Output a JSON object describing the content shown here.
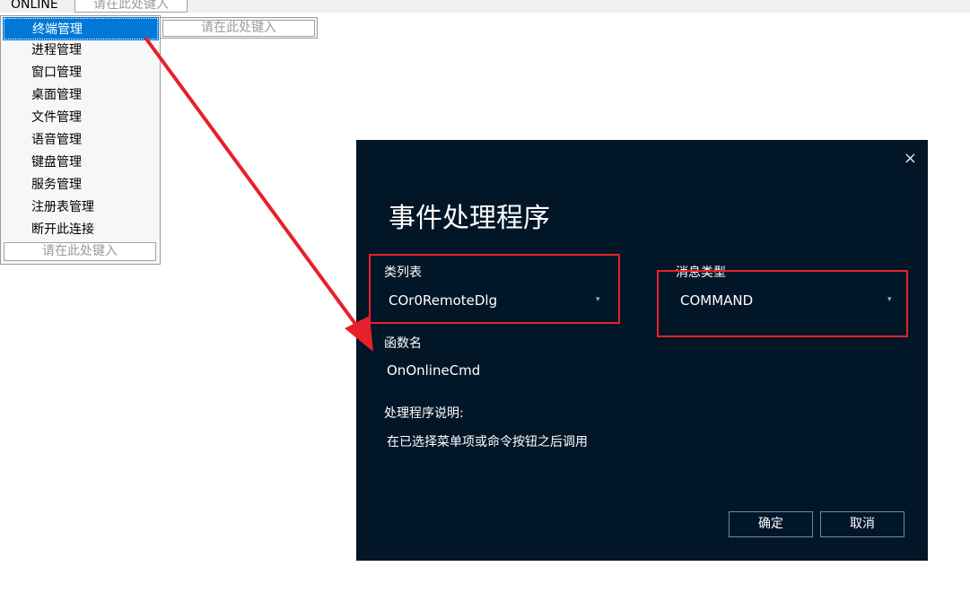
{
  "menubar": {
    "online_label": "ONLINE",
    "input_placeholder": "请在此处键入"
  },
  "dropdown": {
    "items": [
      {
        "label": "终端管理",
        "selected": true
      },
      {
        "label": "进程管理"
      },
      {
        "label": "窗口管理"
      },
      {
        "label": "桌面管理"
      },
      {
        "label": "文件管理"
      },
      {
        "label": "语音管理"
      },
      {
        "label": "键盘管理"
      },
      {
        "label": "服务管理"
      },
      {
        "label": "注册表管理"
      },
      {
        "label": "断开此连接"
      }
    ],
    "input_placeholder": "请在此处键入",
    "submenu_input_placeholder": "请在此处键入"
  },
  "dialog": {
    "title": "事件处理程序",
    "close_icon": "×",
    "class_list_label": "类列表",
    "class_list_value": "COr0RemoteDlg",
    "message_type_label": "消息类型",
    "message_type_value": "COMMAND",
    "function_name_label": "函数名",
    "function_name_value": "OnOnlineCmd",
    "description_label": "处理程序说明:",
    "description_text": "在已选择菜单项或命令按钮之后调用",
    "ok_label": "确定",
    "cancel_label": "取消",
    "dropdown_caret": "▾"
  },
  "annotation_color": "#e8202a",
  "selection_color": "#0078d7",
  "dialog_background": "#011627"
}
